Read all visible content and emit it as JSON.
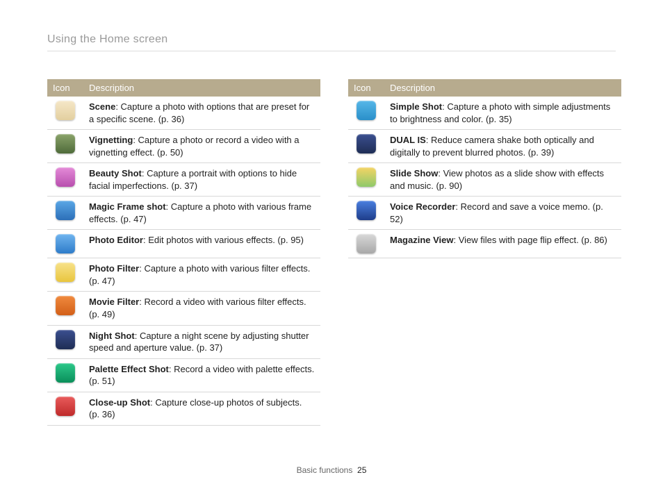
{
  "header": {
    "title": "Using the Home screen"
  },
  "tableHeaders": {
    "icon": "Icon",
    "description": "Description"
  },
  "footer": {
    "section": "Basic functions",
    "page": "25"
  },
  "leftRows": [
    {
      "iconBg": "linear-gradient(#f5e7c8,#e3cf9f)",
      "title": "Scene",
      "rest": ": Capture a photo with options that are preset for a specific scene. (p. 36)"
    },
    {
      "iconBg": "linear-gradient(#8aa36a,#4f6b3a)",
      "title": "Vignetting",
      "rest": ": Capture a photo or record a video with a vignetting effect. (p. 50)"
    },
    {
      "iconBg": "linear-gradient(#e48bd8,#b84fae)",
      "title": "Beauty Shot",
      "rest": ": Capture a portrait with options to hide facial imperfections. (p. 37)"
    },
    {
      "iconBg": "linear-gradient(#5aa7e6,#2c6fb8)",
      "title": "Magic Frame shot",
      "rest": ": Capture a photo with various frame effects. (p. 47)"
    },
    {
      "iconBg": "linear-gradient(#6fb4ef,#2e7cc9)",
      "title": "Photo Editor",
      "rest": ": Edit photos with various effects. (p. 95)"
    },
    {
      "iconBg": "linear-gradient(#f7e28a,#e9c63e)",
      "title": "Photo Filter",
      "rest": ": Capture a photo with various filter effects. (p. 47)"
    },
    {
      "iconBg": "linear-gradient(#f08a3e,#d25f18)",
      "title": "Movie Filter",
      "rest": ": Record a video with various filter effects. (p. 49)"
    },
    {
      "iconBg": "linear-gradient(#3b4f8f,#1e2d55)",
      "title": "Night Shot",
      "rest": ": Capture a night scene by adjusting shutter speed and aperture value. (p. 37)"
    },
    {
      "iconBg": "linear-gradient(#2cc88a,#0a8f5a)",
      "title": "Palette Effect Shot",
      "rest": ": Record a video with palette effects. (p. 51)"
    },
    {
      "iconBg": "linear-gradient(#e95b5b,#bf2b2b)",
      "title": "Close-up Shot",
      "rest": ": Capture close-up photos of subjects. (p. 36)"
    }
  ],
  "rightRows": [
    {
      "iconBg": "linear-gradient(#57b7e8,#2a8fc9)",
      "title": "Simple Shot",
      "rest": ": Capture a photo with simple adjustments to brightness and color. (p. 35)"
    },
    {
      "iconBg": "linear-gradient(#3b4f8f,#1e2d55)",
      "title": "DUAL IS",
      "rest": ": Reduce camera shake both optically and digitally to prevent blurred photos. (p. 39)"
    },
    {
      "iconBg": "linear-gradient(#f4d465,#8fc96a)",
      "title": "Slide Show",
      "rest": ": View photos as a slide show with effects and music. (p. 90)"
    },
    {
      "iconBg": "linear-gradient(#4a7fe0,#1e3d8a)",
      "title": "Voice Recorder",
      "rest": ": Record and save a voice memo. (p. 52)"
    },
    {
      "iconBg": "linear-gradient(#d8d8d8,#a8a8a8)",
      "title": "Magazine View",
      "rest": ": View files with page flip effect. (p. 86)"
    }
  ]
}
